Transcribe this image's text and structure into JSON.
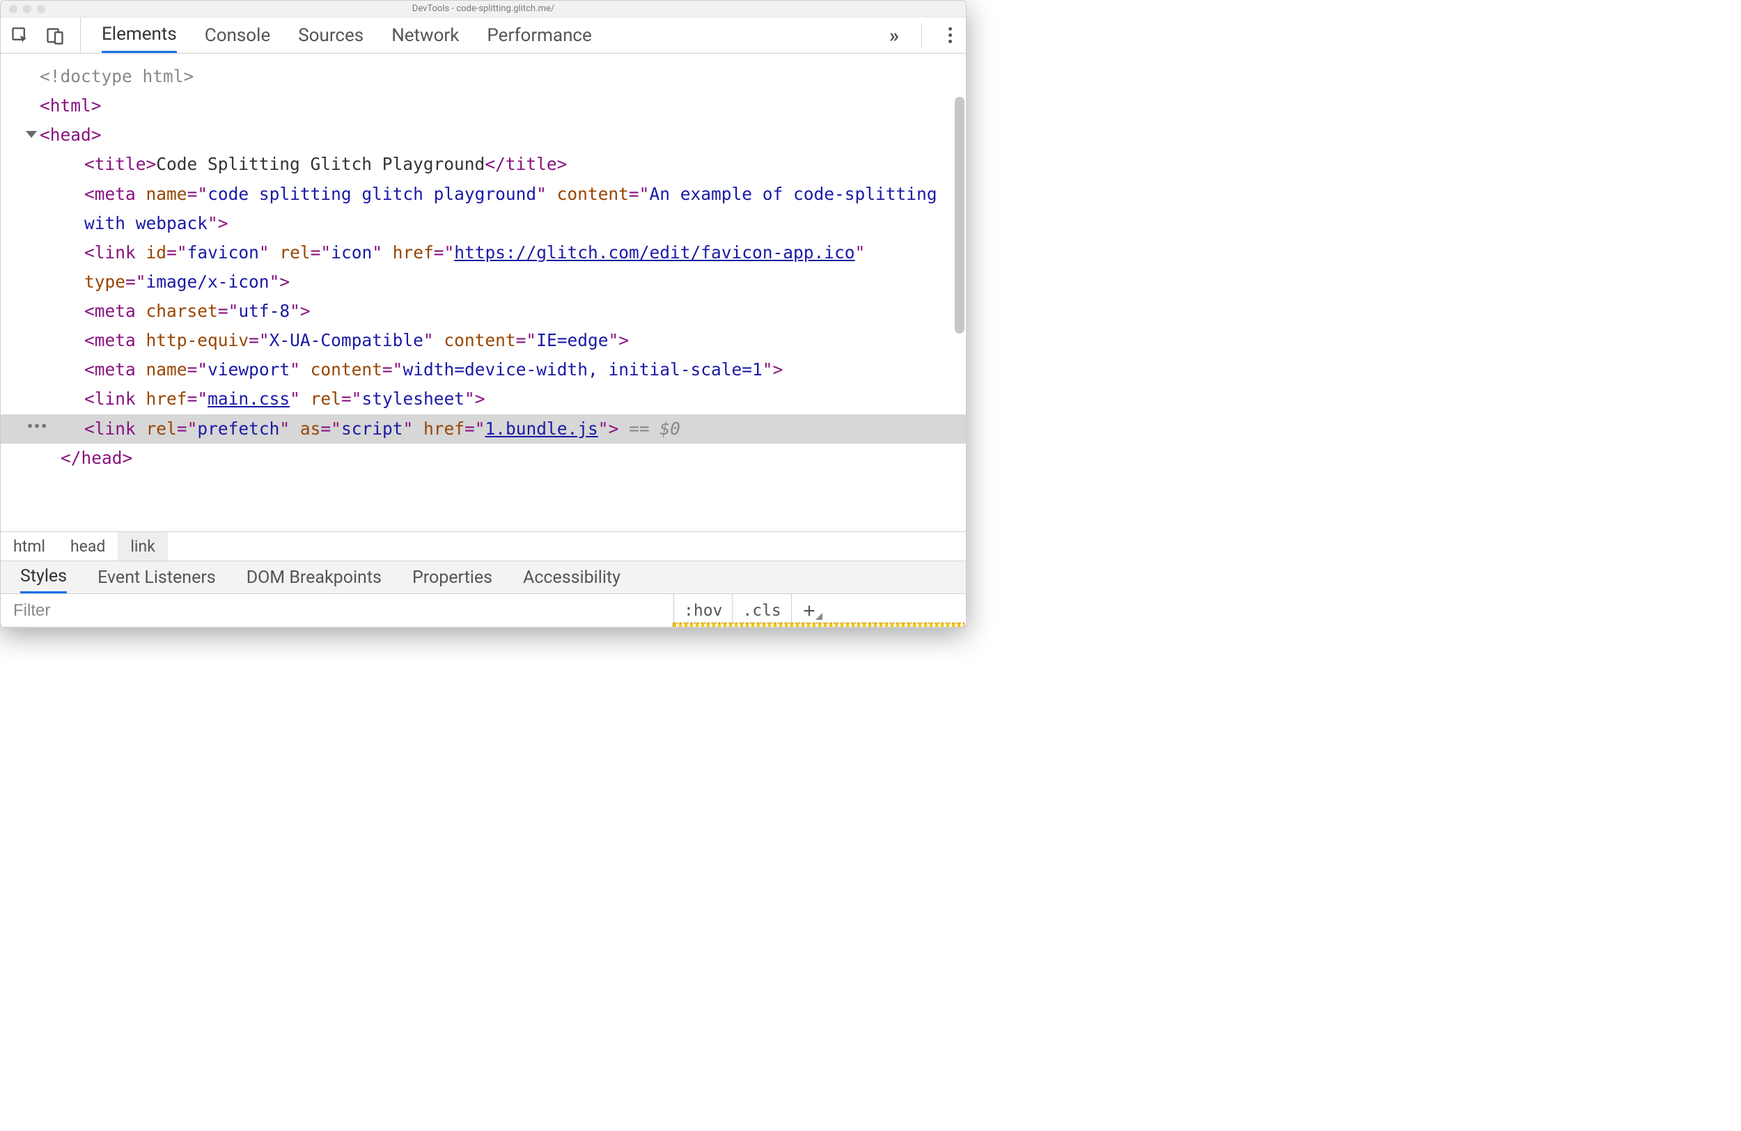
{
  "window_title": "DevTools - code-splitting.glitch.me/",
  "tabs": {
    "elements": "Elements",
    "console": "Console",
    "sources": "Sources",
    "network": "Network",
    "performance": "Performance"
  },
  "dom": {
    "doctype": "<!doctype html>",
    "html_open": "html",
    "head_open": "head",
    "title_tag": "title",
    "title_text": "Code Splitting Glitch Playground",
    "meta1_attr_name": "name",
    "meta1_name": "code splitting glitch playground",
    "meta1_attr_content": "content",
    "meta1_content": "An example of code-splitting with webpack",
    "link1_id": "favicon",
    "link1_rel": "icon",
    "link1_href": "https://glitch.com/edit/favicon-app.ico",
    "link1_type": "image/x-icon",
    "meta2_charset": "utf-8",
    "meta3_http_equiv": "X-UA-Compatible",
    "meta3_content": "IE=edge",
    "meta4_name": "viewport",
    "meta4_content": "width=device-width, initial-scale=1",
    "link2_href": "main.css",
    "link2_rel": "stylesheet",
    "link3_rel": "prefetch",
    "link3_as": "script",
    "link3_href": "1.bundle.js",
    "sel_suffix": " == $0",
    "head_close": "head"
  },
  "breadcrumb": {
    "html": "html",
    "head": "head",
    "link": "link"
  },
  "subtabs": {
    "styles": "Styles",
    "event_listeners": "Event Listeners",
    "dom_breakpoints": "DOM Breakpoints",
    "properties": "Properties",
    "accessibility": "Accessibility"
  },
  "styles_bar": {
    "filter_placeholder": "Filter",
    "hov": ":hov",
    "cls": ".cls"
  }
}
